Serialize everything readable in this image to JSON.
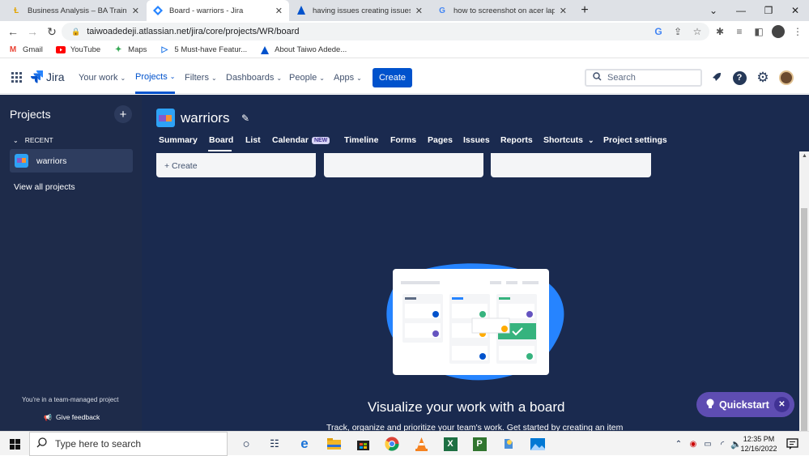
{
  "browser": {
    "tabs": [
      {
        "title": "Business Analysis – BA Training &",
        "icon": "ba-training-icon"
      },
      {
        "title": "Board - warriors - Jira",
        "icon": "jira-icon",
        "active": true
      },
      {
        "title": "having issues creating issues on",
        "icon": "atlassian-icon"
      },
      {
        "title": "how to screenshot on acer laptop",
        "icon": "google-icon"
      }
    ],
    "url": "taiwoadedeji.atlassian.net/jira/core/projects/WR/board",
    "bookmarks": [
      {
        "label": "Gmail",
        "icon": "gmail-icon"
      },
      {
        "label": "YouTube",
        "icon": "youtube-icon"
      },
      {
        "label": "Maps",
        "icon": "maps-icon"
      },
      {
        "label": "5 Must-have Featur...",
        "icon": "bookmark-icon"
      },
      {
        "label": "About Taiwo Adede...",
        "icon": "atlassian-icon"
      }
    ]
  },
  "jira": {
    "logo": "Jira",
    "nav": [
      {
        "label": "Your work"
      },
      {
        "label": "Projects",
        "active": true
      },
      {
        "label": "Filters"
      },
      {
        "label": "Dashboards"
      },
      {
        "label": "People"
      },
      {
        "label": "Apps"
      }
    ],
    "create_label": "Create",
    "search_placeholder": "Search"
  },
  "sidebar": {
    "title": "Projects",
    "recent_label": "RECENT",
    "project_name": "warriors",
    "view_all": "View all projects",
    "managed_note": "You're in a team-managed project",
    "feedback": "Give feedback"
  },
  "project": {
    "name": "warriors",
    "tabs": [
      {
        "label": "Summary"
      },
      {
        "label": "Board",
        "active": true
      },
      {
        "label": "List"
      },
      {
        "label": "Calendar",
        "badge": "NEW"
      },
      {
        "label": "Timeline"
      },
      {
        "label": "Forms"
      },
      {
        "label": "Pages"
      },
      {
        "label": "Issues"
      },
      {
        "label": "Reports"
      },
      {
        "label": "Shortcuts"
      },
      {
        "label": "Project settings"
      }
    ],
    "column_create": "+ Create",
    "empty_title": "Visualize your work with a board",
    "empty_sub": "Track, organize and prioritize your team's work. Get started by creating an item"
  },
  "quickstart": {
    "label": "Quickstart"
  },
  "taskbar": {
    "search_placeholder": "Type here to search",
    "time": "12:35 PM",
    "date": "12/16/2022"
  },
  "colors": {
    "accent": "#0052cc",
    "sidebar_bg": "#1e2b4a",
    "main_bg": "#1a2a4f",
    "quickstart": "#5e4db2"
  }
}
